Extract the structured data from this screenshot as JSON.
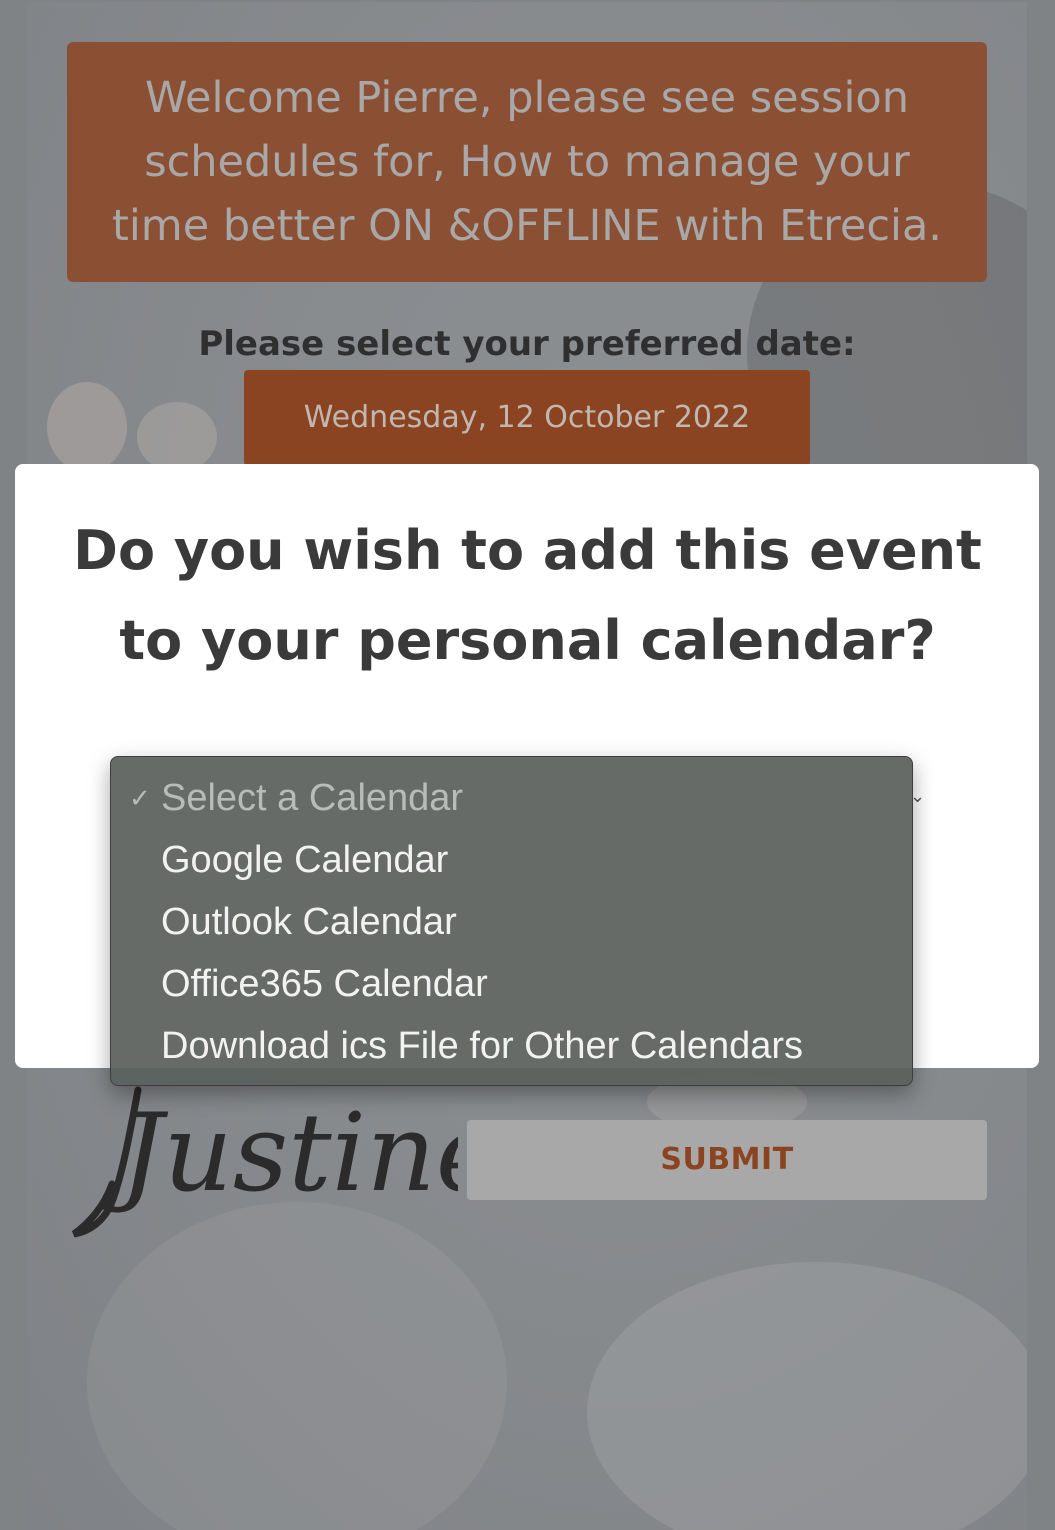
{
  "banner": {
    "text": "Welcome Pierre, please see session schedules for, How to manage your time better ON &OFFLINE with Etrecia."
  },
  "date_picker": {
    "prompt": "Please select your preferred date:",
    "selected_date": "Wednesday, 12 October 2022"
  },
  "modal": {
    "title": "Do you wish to add this event to your personal calendar?"
  },
  "calendar_select": {
    "options": [
      {
        "label": "Select a Calendar",
        "selected": true
      },
      {
        "label": "Google Calendar",
        "selected": false
      },
      {
        "label": "Outlook Calendar",
        "selected": false
      },
      {
        "label": "Office365 Calendar",
        "selected": false
      },
      {
        "label": "Download ics File for Other Calendars",
        "selected": false
      }
    ]
  },
  "signature": {
    "text": "Justine"
  },
  "form": {
    "submit_label": "SUBMIT"
  },
  "colors": {
    "banner_bg": "#8b4f34",
    "date_button_bg": "#8a4421",
    "submit_text": "#8b4421",
    "overlay": "#808386"
  },
  "icons": {
    "check": "check-icon",
    "caret": "chevron-down-icon"
  }
}
